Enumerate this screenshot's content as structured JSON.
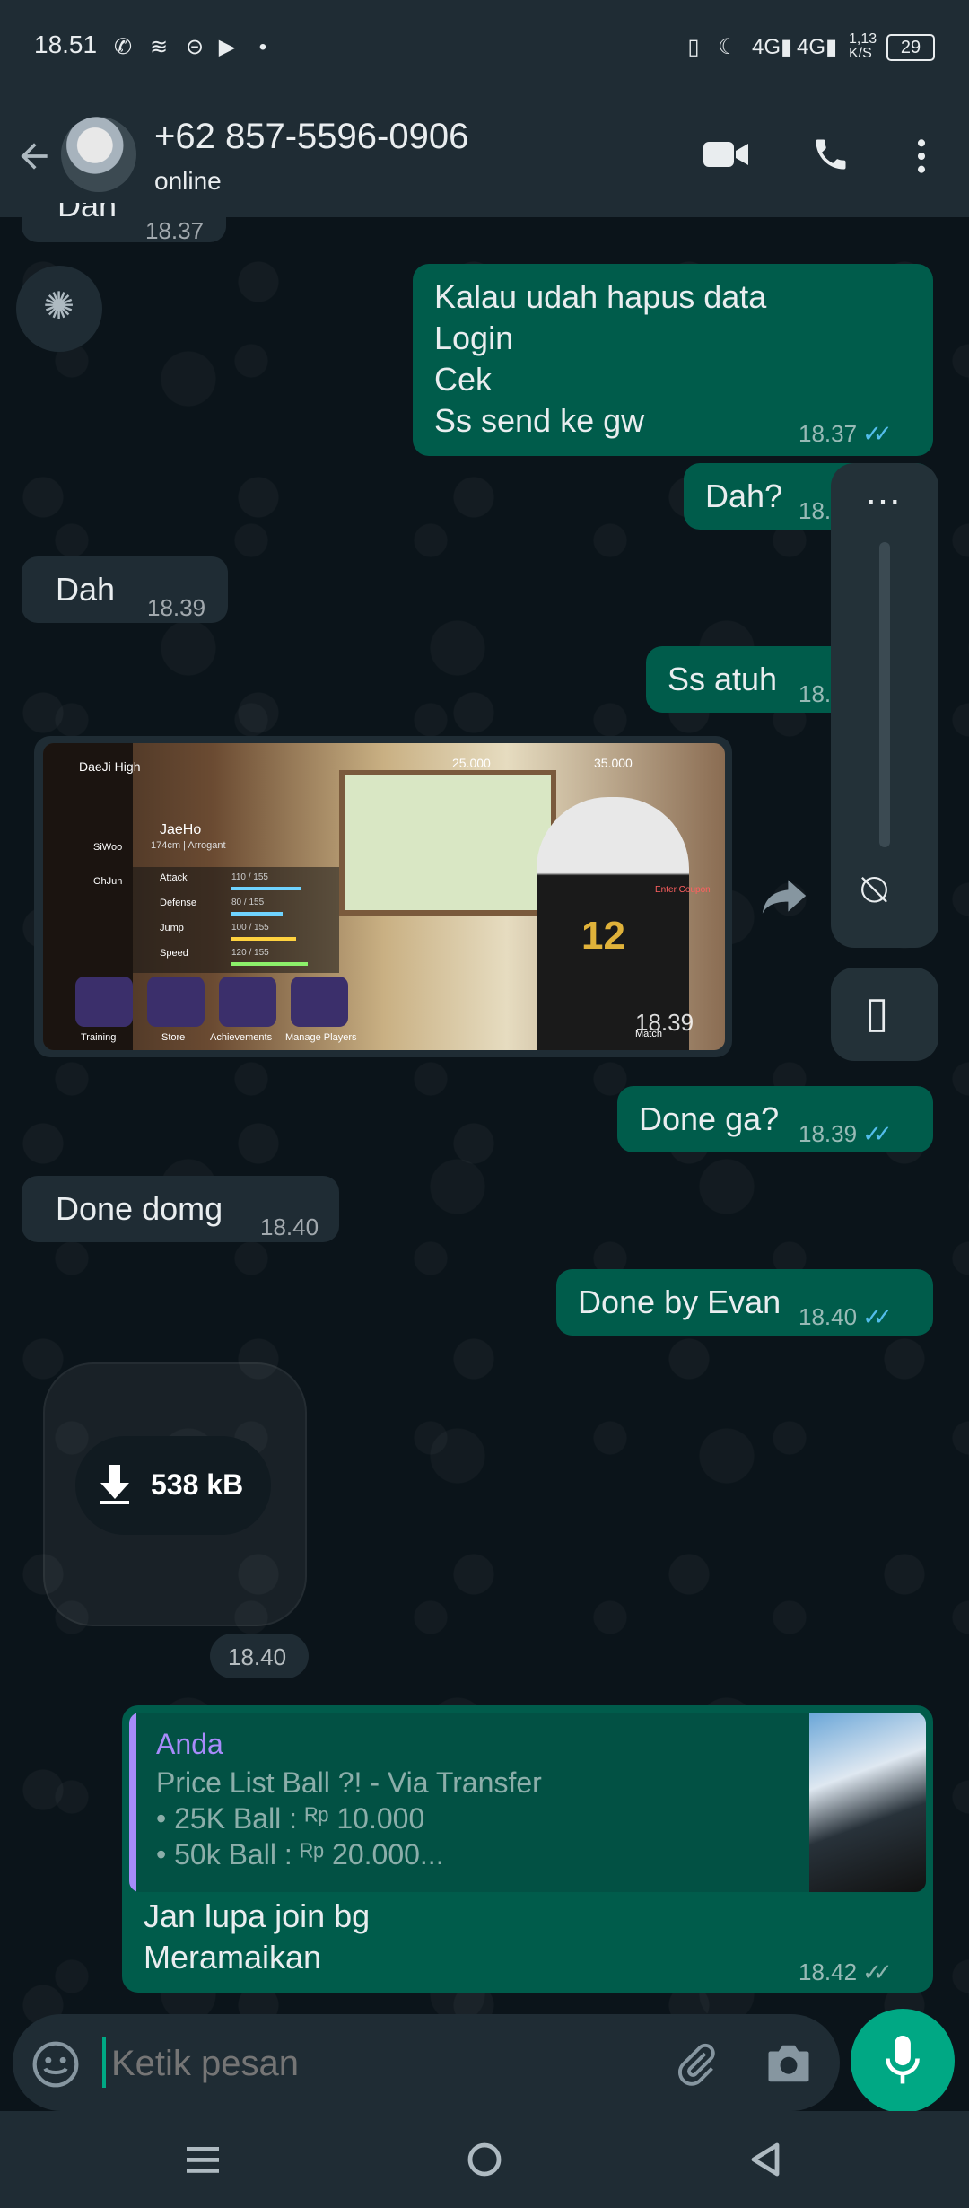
{
  "status_bar": {
    "time": "18.51",
    "network_speed": "1,13\nK/S",
    "battery": "29"
  },
  "header": {
    "contact": "+62 857-5596-0906",
    "status": "online"
  },
  "messages": [
    {
      "id": "m0",
      "text": "Dah",
      "time": "18.37"
    },
    {
      "id": "m1",
      "lines": [
        "Kalau udah hapus data",
        "Login",
        "Cek",
        "Ss send ke gw"
      ],
      "time": "18.37"
    },
    {
      "id": "m2",
      "text": "Dah?",
      "time": "18.37"
    },
    {
      "id": "m3",
      "text": "Dah",
      "time": "18.39"
    },
    {
      "id": "m4",
      "text": "Ss atuh",
      "time": "18.39"
    },
    {
      "id": "m5",
      "type": "image",
      "time": "18.39"
    },
    {
      "id": "m6",
      "text": "Done ga?",
      "time": "18.39"
    },
    {
      "id": "m7",
      "text": "Done domg",
      "time": "18.40"
    },
    {
      "id": "m8",
      "text": "Done by Evan",
      "time": "18.40"
    },
    {
      "id": "m9",
      "type": "sticker-download",
      "size": "538 kB",
      "time": "18.40"
    },
    {
      "id": "m10",
      "quote_author": "Anda",
      "quote_lines": [
        "Price List Ball ?! - Via Transfer",
        "• 25K Ball : ᴿᵖ 10.000",
        "• 50k Ball : ᴿᵖ 20.000..."
      ],
      "lines": [
        "Jan lupa join bg",
        "Meramaikan"
      ],
      "time": "18.42"
    }
  ],
  "game": {
    "school": "DaeJi High",
    "money1": "25.000",
    "money2": "35.000",
    "char_name": "JaeHo",
    "char_info": "174cm | Arrogant",
    "players": [
      "SiWoo",
      "OhJun"
    ],
    "stats": [
      {
        "label": "Attack",
        "value": "110 / 155",
        "fill": 0.71
      },
      {
        "label": "Defense",
        "value": "80 / 155",
        "fill": 0.52
      },
      {
        "label": "Jump",
        "value": "100 / 155",
        "fill": 0.65
      },
      {
        "label": "Speed",
        "value": "120 / 155",
        "fill": 0.77
      }
    ],
    "buttons": [
      "Training",
      "Store",
      "Achievements",
      "Manage Players"
    ],
    "jersey": "12",
    "coupon": "Enter Coupon",
    "match": "Match"
  },
  "composer": {
    "placeholder": "Ketik pesan"
  }
}
